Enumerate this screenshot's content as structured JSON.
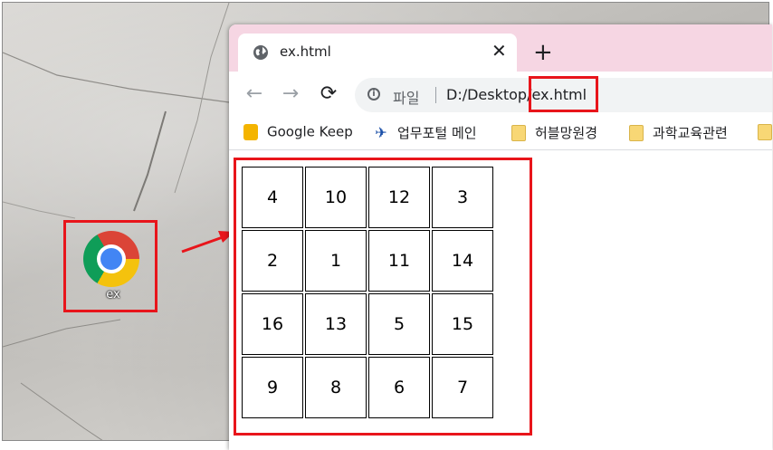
{
  "desktop": {
    "icon_label": "ex"
  },
  "browser": {
    "tab": {
      "title": "ex.html",
      "close_glyph": "✕",
      "favicon": "globe-icon"
    },
    "new_tab_glyph": "+",
    "toolbar": {
      "back_glyph": "←",
      "forward_glyph": "→",
      "reload_glyph": "⟳",
      "info_glyph": "i",
      "scheme_label": "파일",
      "url": "D:/Desktop/ex.html"
    },
    "bookmarks": [
      {
        "label": "Google Keep",
        "icon": "keep-icon"
      },
      {
        "label": "업무포털 메인",
        "icon": "portal-icon"
      },
      {
        "label": "허블망원경",
        "icon": "folder-icon"
      },
      {
        "label": "과학교육관련",
        "icon": "folder-icon"
      }
    ]
  },
  "table": {
    "rows": [
      [
        "4",
        "10",
        "12",
        "3"
      ],
      [
        "2",
        "1",
        "11",
        "14"
      ],
      [
        "16",
        "13",
        "5",
        "15"
      ],
      [
        "9",
        "8",
        "6",
        "7"
      ]
    ]
  },
  "colors": {
    "highlight": "#e8151b",
    "tabstrip": "#f6d6e3"
  }
}
